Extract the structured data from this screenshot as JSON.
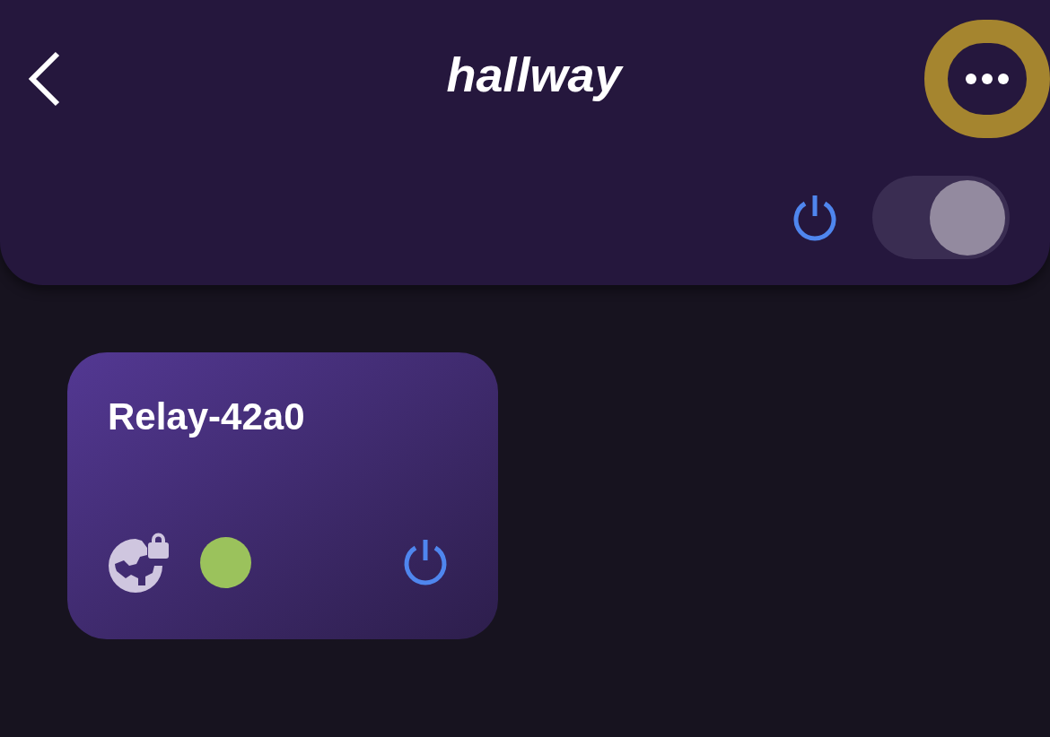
{
  "header": {
    "title": "hallway",
    "group_switch": {
      "on": true
    }
  },
  "devices": [
    {
      "name": "Relay-42a0",
      "color": "#9bc25c"
    }
  ]
}
